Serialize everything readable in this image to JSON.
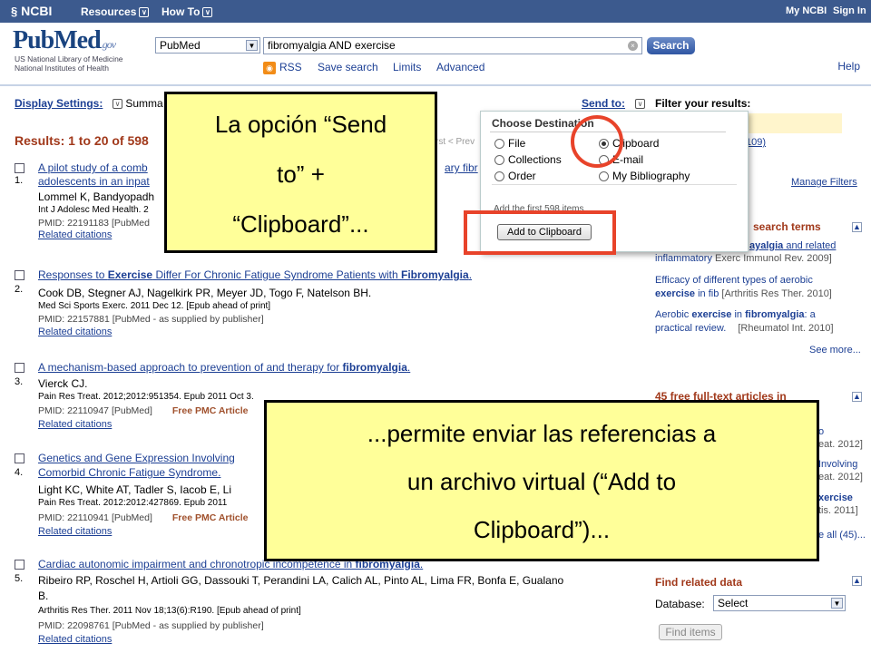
{
  "topbar": {
    "ncbi": "NCBI",
    "resources": "Resources",
    "howto": "How To",
    "myncbi": "My NCBI",
    "signin": "Sign In",
    "chevron": "∨"
  },
  "header": {
    "logo_pub": "PubMed",
    "logo_gov": ".gov",
    "logo_line1": "US National Library of Medicine",
    "logo_line2": "National Institutes of Health",
    "db_value": "PubMed",
    "search_value": "fibromyalgia AND exercise",
    "search_button": "Search",
    "rss": "RSS",
    "save_search": "Save search",
    "limits": "Limits",
    "advanced": "Advanced",
    "help": "Help"
  },
  "toolbar": {
    "display_settings": "Display Settings:",
    "display_value": "Summa",
    "send_to": "Send to:"
  },
  "results": {
    "header": "Results: 1 to 20 of 598",
    "pager": "rst  < Prev"
  },
  "items": [
    {
      "num": "1.",
      "t1": "A pilot study of a comb",
      "t1b": "ary fibr",
      "t2": "adolescents in an inpat",
      "auth": "Lommel K, Bandyopadh",
      "jour": "Int J Adolesc Med Health. 2",
      "pmid": "PMID: 22191183 [PubMed",
      "rel": "Related citations"
    },
    {
      "num": "2.",
      "t_pre": "Responses to ",
      "t_b1": "Exercise",
      "t_mid": " Differ For Chronic Fatigue Syndrome Patients with ",
      "t_b2": "Fibromyalgia",
      "t_end": ".",
      "auth": "Cook DB, Stegner AJ, Nagelkirk PR, Meyer JD, Togo F, Natelson BH.",
      "jour": "Med Sci Sports Exerc. 2011 Dec 12. [Epub ahead of print]",
      "pmid": "PMID: 22157881 [PubMed - as supplied by publisher]",
      "rel": "Related citations"
    },
    {
      "num": "3.",
      "t_pre": "A mechanism-based approach to prevention of and therapy for ",
      "t_b1": "fibromyalgia",
      "t_end": ".",
      "auth": "Vierck CJ.",
      "jour": "Pain Res Treat. 2012;2012:951354. Epub 2011 Oct 3.",
      "pmid": "PMID: 22110947 [PubMed]",
      "free": "Free PMC Article",
      "rel": "Related citations"
    },
    {
      "num": "4.",
      "t1": "Genetics and Gene Expression Involving",
      "t2": "Comorbid Chronic Fatigue Syndrome.",
      "auth": "Light KC, White AT, Tadler S, Iacob E, Li",
      "jour": "Pain Res Treat. 2012:2012:427869. Epub 2011",
      "pmid": "PMID: 22110941 [PubMed]",
      "free": "Free PMC Article",
      "rel": "Related citations"
    },
    {
      "num": "5.",
      "t_pre": "Cardiac autonomic impairment and chronotropic incompetence in ",
      "t_b1": "fibromyalgia",
      "t_end": ".",
      "auth": "Ribeiro RP, Roschel H, Artioli GG, Dassouki T, Perandini LA, Calich AL, Pinto AL, Lima FR, Bonfa E, Gualano",
      "auth2": "B.",
      "jour": "Arthritis Res Ther. 2011 Nov 18;13(6):R190. [Epub ahead of print]",
      "pmid": "PMID: 22098761 [PubMed - as supplied by publisher]",
      "rel": "Related citations"
    }
  ],
  "popup": {
    "title": "Choose Destination",
    "options": [
      "File",
      "Clipboard",
      "Collections",
      "E-mail",
      "Order",
      "My Bibliography"
    ],
    "selected": "Clipboard",
    "note": "Add the first 598 items",
    "add_button": "Add to Clipboard"
  },
  "sidebar": {
    "filter_title": "Filter your results:",
    "filter_count": "109)",
    "manage_filters": "Manage Filters",
    "search_terms_head": "search terms",
    "st1a": "ayalgia",
    "st1b": " and related",
    "st1c": "inflammatory",
    "st1d": "Exerc Immunol Rev. 2009]",
    "st2a": "Efficacy of different types of aerobic",
    "st2b": "exercise",
    "st2c": " in fib",
    "st2d": "[Arthritis Res Ther. 2010]",
    "st3a": "Aerobic ",
    "st3b": "exercise",
    "st3c": " in ",
    "st3d": "fibromyalgia",
    "st3e": ": a",
    "st3f": "practical review.",
    "st3g": "[Rheumatol Int. 2010]",
    "see_more": "See more...",
    "free_head": "45 free full-text articles in",
    "f1": "o",
    "f2": "eat. 2012]",
    "f3": "Involving",
    "f4": "eat. 2012]",
    "f5": "xercise",
    "f6": "tis. 2011]",
    "f7": "e all (45)...",
    "related_head": "Find related data",
    "database_label": "Database:",
    "database_value": "Select",
    "find_items": "Find items"
  },
  "callouts": {
    "c1": [
      "La opción “Send",
      "to” +",
      "“Clipboard”..."
    ],
    "c2": [
      "...permite enviar las referencias a",
      "un archivo virtual (“Add to",
      "Clipboard”)..."
    ]
  },
  "colors": {
    "topbar": "#3c5a8e",
    "callout": "#ffff99",
    "highlight_red": "#e8432a",
    "section_head": "#a1391b"
  }
}
